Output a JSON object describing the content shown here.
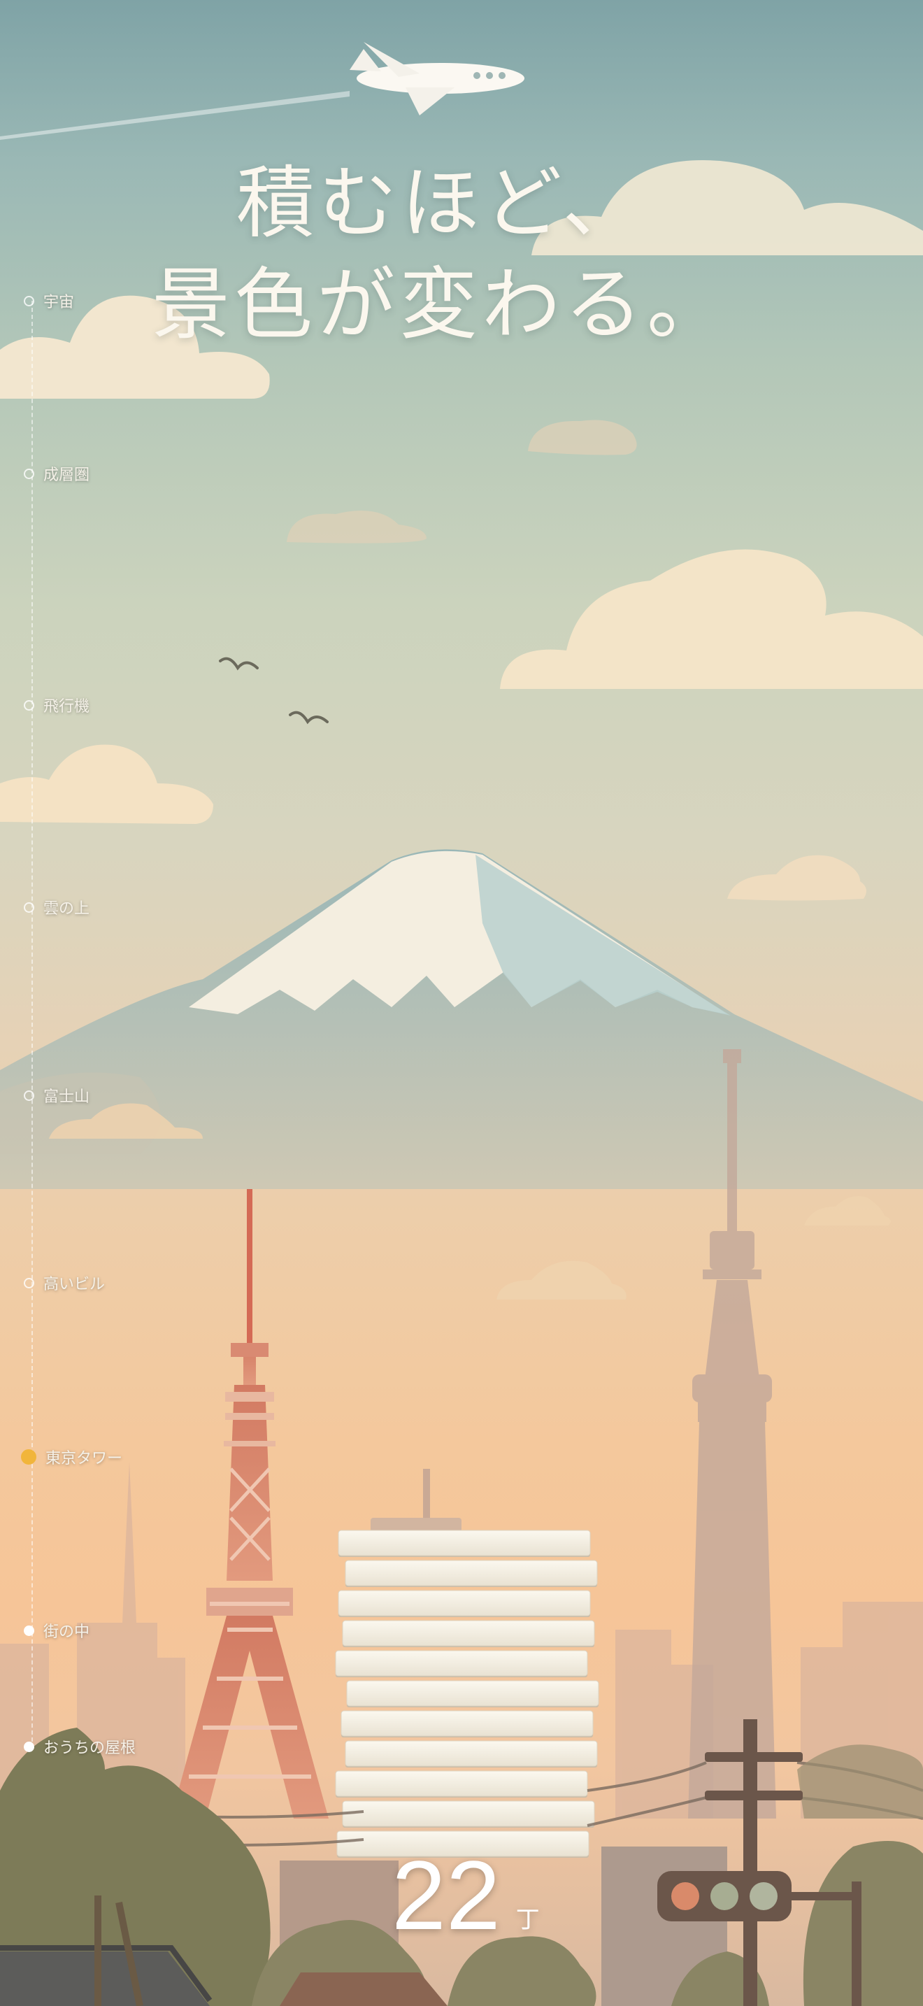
{
  "headline": {
    "line1": "積むほど、",
    "line2": "景色が変わる。"
  },
  "timeline": {
    "stages": [
      {
        "label": "宇宙",
        "state": "upcoming"
      },
      {
        "label": "成層圏",
        "state": "upcoming"
      },
      {
        "label": "飛行機",
        "state": "upcoming"
      },
      {
        "label": "雲の上",
        "state": "upcoming"
      },
      {
        "label": "富士山",
        "state": "upcoming"
      },
      {
        "label": "高いビル",
        "state": "upcoming"
      },
      {
        "label": "東京タワー",
        "state": "current"
      },
      {
        "label": "街の中",
        "state": "passed"
      },
      {
        "label": "おうちの屋根",
        "state": "passed"
      }
    ]
  },
  "stack": {
    "count": "22",
    "unit": "丁",
    "visible_blocks": 11
  },
  "colors": {
    "sky_top": "#7fa3a6",
    "sky_bottom": "#f6c598",
    "active_dot": "#f1b53b",
    "block": "#f6f1e4",
    "tokyo_tower": "#d9826a"
  },
  "icons": [
    "airplane-icon",
    "bird-icon",
    "mount-fuji",
    "tokyo-tower",
    "skytree",
    "traffic-light",
    "utility-pole",
    "house-roof"
  ]
}
